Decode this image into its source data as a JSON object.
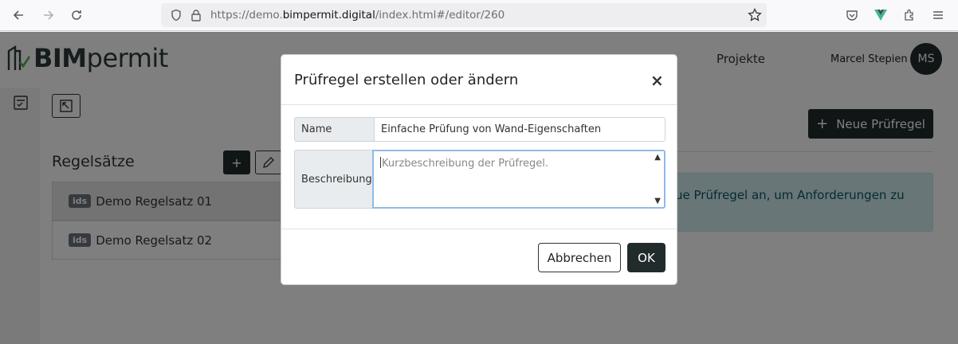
{
  "browser": {
    "url_prefix": "https://demo.",
    "url_domain": "bimpermit.digital",
    "url_suffix": "/index.html#/editor/260"
  },
  "app": {
    "logo_bold": "BIM",
    "logo_light": "permit",
    "nav_projects": "Projekte",
    "user_name": "Marcel Stepien",
    "user_initials": "MS"
  },
  "left_panel": {
    "title": "Regelsätze",
    "add_label": "+",
    "rulesets": [
      {
        "badge": "ids",
        "name": "Demo Regelsatz 01"
      },
      {
        "badge": "ids",
        "name": "Demo Regelsatz 02"
      }
    ]
  },
  "right_panel": {
    "new_rule_label": "Neue Prüfregel",
    "info_line1": "ue Prüfregel an, um Anforderungen zu"
  },
  "modal": {
    "title": "Prüfregel erstellen oder ändern",
    "close": "×",
    "name_label": "Name",
    "name_value": "Einfache Prüfung von Wand-Eigenschaften",
    "desc_label": "Beschreibung",
    "desc_placeholder": "Kurzbeschreibung der Prüfregel.",
    "cancel_label": "Abbrechen",
    "ok_label": "OK"
  }
}
